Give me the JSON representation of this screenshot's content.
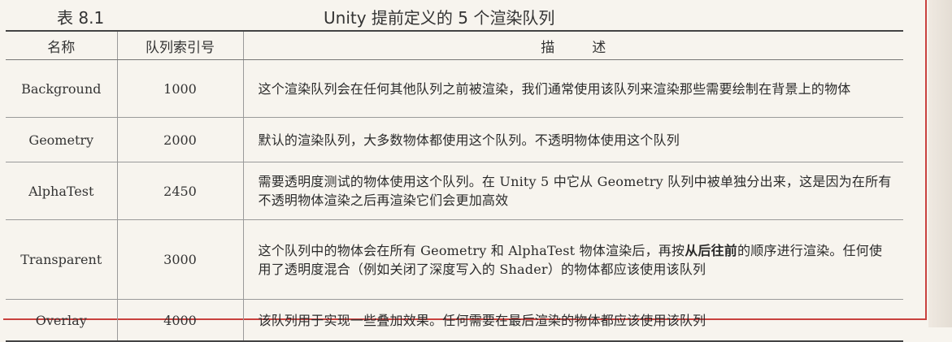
{
  "caption": {
    "number": "表 8.1",
    "title": "Unity 提前定义的 5 个渲染队列"
  },
  "headers": {
    "name": "名称",
    "index": "队列索引号",
    "desc_1": "描",
    "desc_2": "述"
  },
  "rows": [
    {
      "name": "Background",
      "index": "1000",
      "desc": "这个渲染队列会在任何其他队列之前被渲染，我们通常使用该队列来渲染那些需要绘制在背景上的物体"
    },
    {
      "name": "Geometry",
      "index": "2000",
      "desc": "默认的渲染队列，大多数物体都使用这个队列。不透明物体使用这个队列"
    },
    {
      "name": "AlphaTest",
      "index": "2450",
      "desc": "需要透明度测试的物体使用这个队列。在 Unity 5 中它从 Geometry 队列中被单独分出来，这是因为在所有不透明物体渲染之后再渲染它们会更加高效"
    },
    {
      "name": "Transparent",
      "index": "3000",
      "desc_pre": "这个队列中的物体会在所有 Geometry 和 AlphaTest 物体渲染后，再按",
      "desc_bold": "从后往前",
      "desc_post": "的顺序进行渲染。任何使用了透明度混合（例如关闭了深度写入的 Shader）的物体都应该使用该队列"
    },
    {
      "name": "Overlay",
      "index": "4000",
      "desc": "该队列用于实现一些叠加效果。任何需要在最后渲染的物体都应该使用该队列"
    }
  ]
}
